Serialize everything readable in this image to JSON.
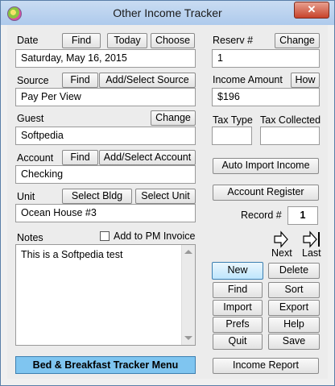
{
  "window": {
    "title": "Other Income Tracker",
    "close_glyph": "✕"
  },
  "date": {
    "label": "Date",
    "find": "Find",
    "today": "Today",
    "choose": "Choose",
    "value": "Saturday, May 16, 2015"
  },
  "source": {
    "label": "Source",
    "find": "Find",
    "add_select": "Add/Select Source",
    "value": "Pay Per View"
  },
  "guest": {
    "label": "Guest",
    "change": "Change",
    "value": "Softpedia"
  },
  "account": {
    "label": "Account",
    "find": "Find",
    "add_select": "Add/Select Account",
    "value": "Checking"
  },
  "unit": {
    "label": "Unit",
    "select_bldg": "Select Bldg",
    "select_unit": "Select Unit",
    "value": "Ocean House #3"
  },
  "notes": {
    "label": "Notes",
    "add_to_pm_invoice": "Add to PM Invoice",
    "value": "This is a Softpedia test"
  },
  "reserv": {
    "label": "Reserv #",
    "change": "Change",
    "value": "1"
  },
  "income": {
    "label": "Income Amount",
    "how": "How",
    "value": "$196"
  },
  "tax": {
    "type_label": "Tax Type",
    "collected_label": "Tax Collected",
    "type_value": "",
    "collected_value": ""
  },
  "actions": {
    "auto_import": "Auto Import Income",
    "account_register": "Account Register"
  },
  "record": {
    "label": "Record #",
    "value": "1"
  },
  "nav": {
    "next": "Next",
    "last": "Last"
  },
  "buttons": {
    "new": "New",
    "delete": "Delete",
    "find": "Find",
    "sort": "Sort",
    "import": "Import",
    "export": "Export",
    "prefs": "Prefs",
    "help": "Help",
    "quit": "Quit",
    "save": "Save"
  },
  "footer": {
    "menu": "Bed & Breakfast Tracker Menu",
    "income_report": "Income Report"
  }
}
